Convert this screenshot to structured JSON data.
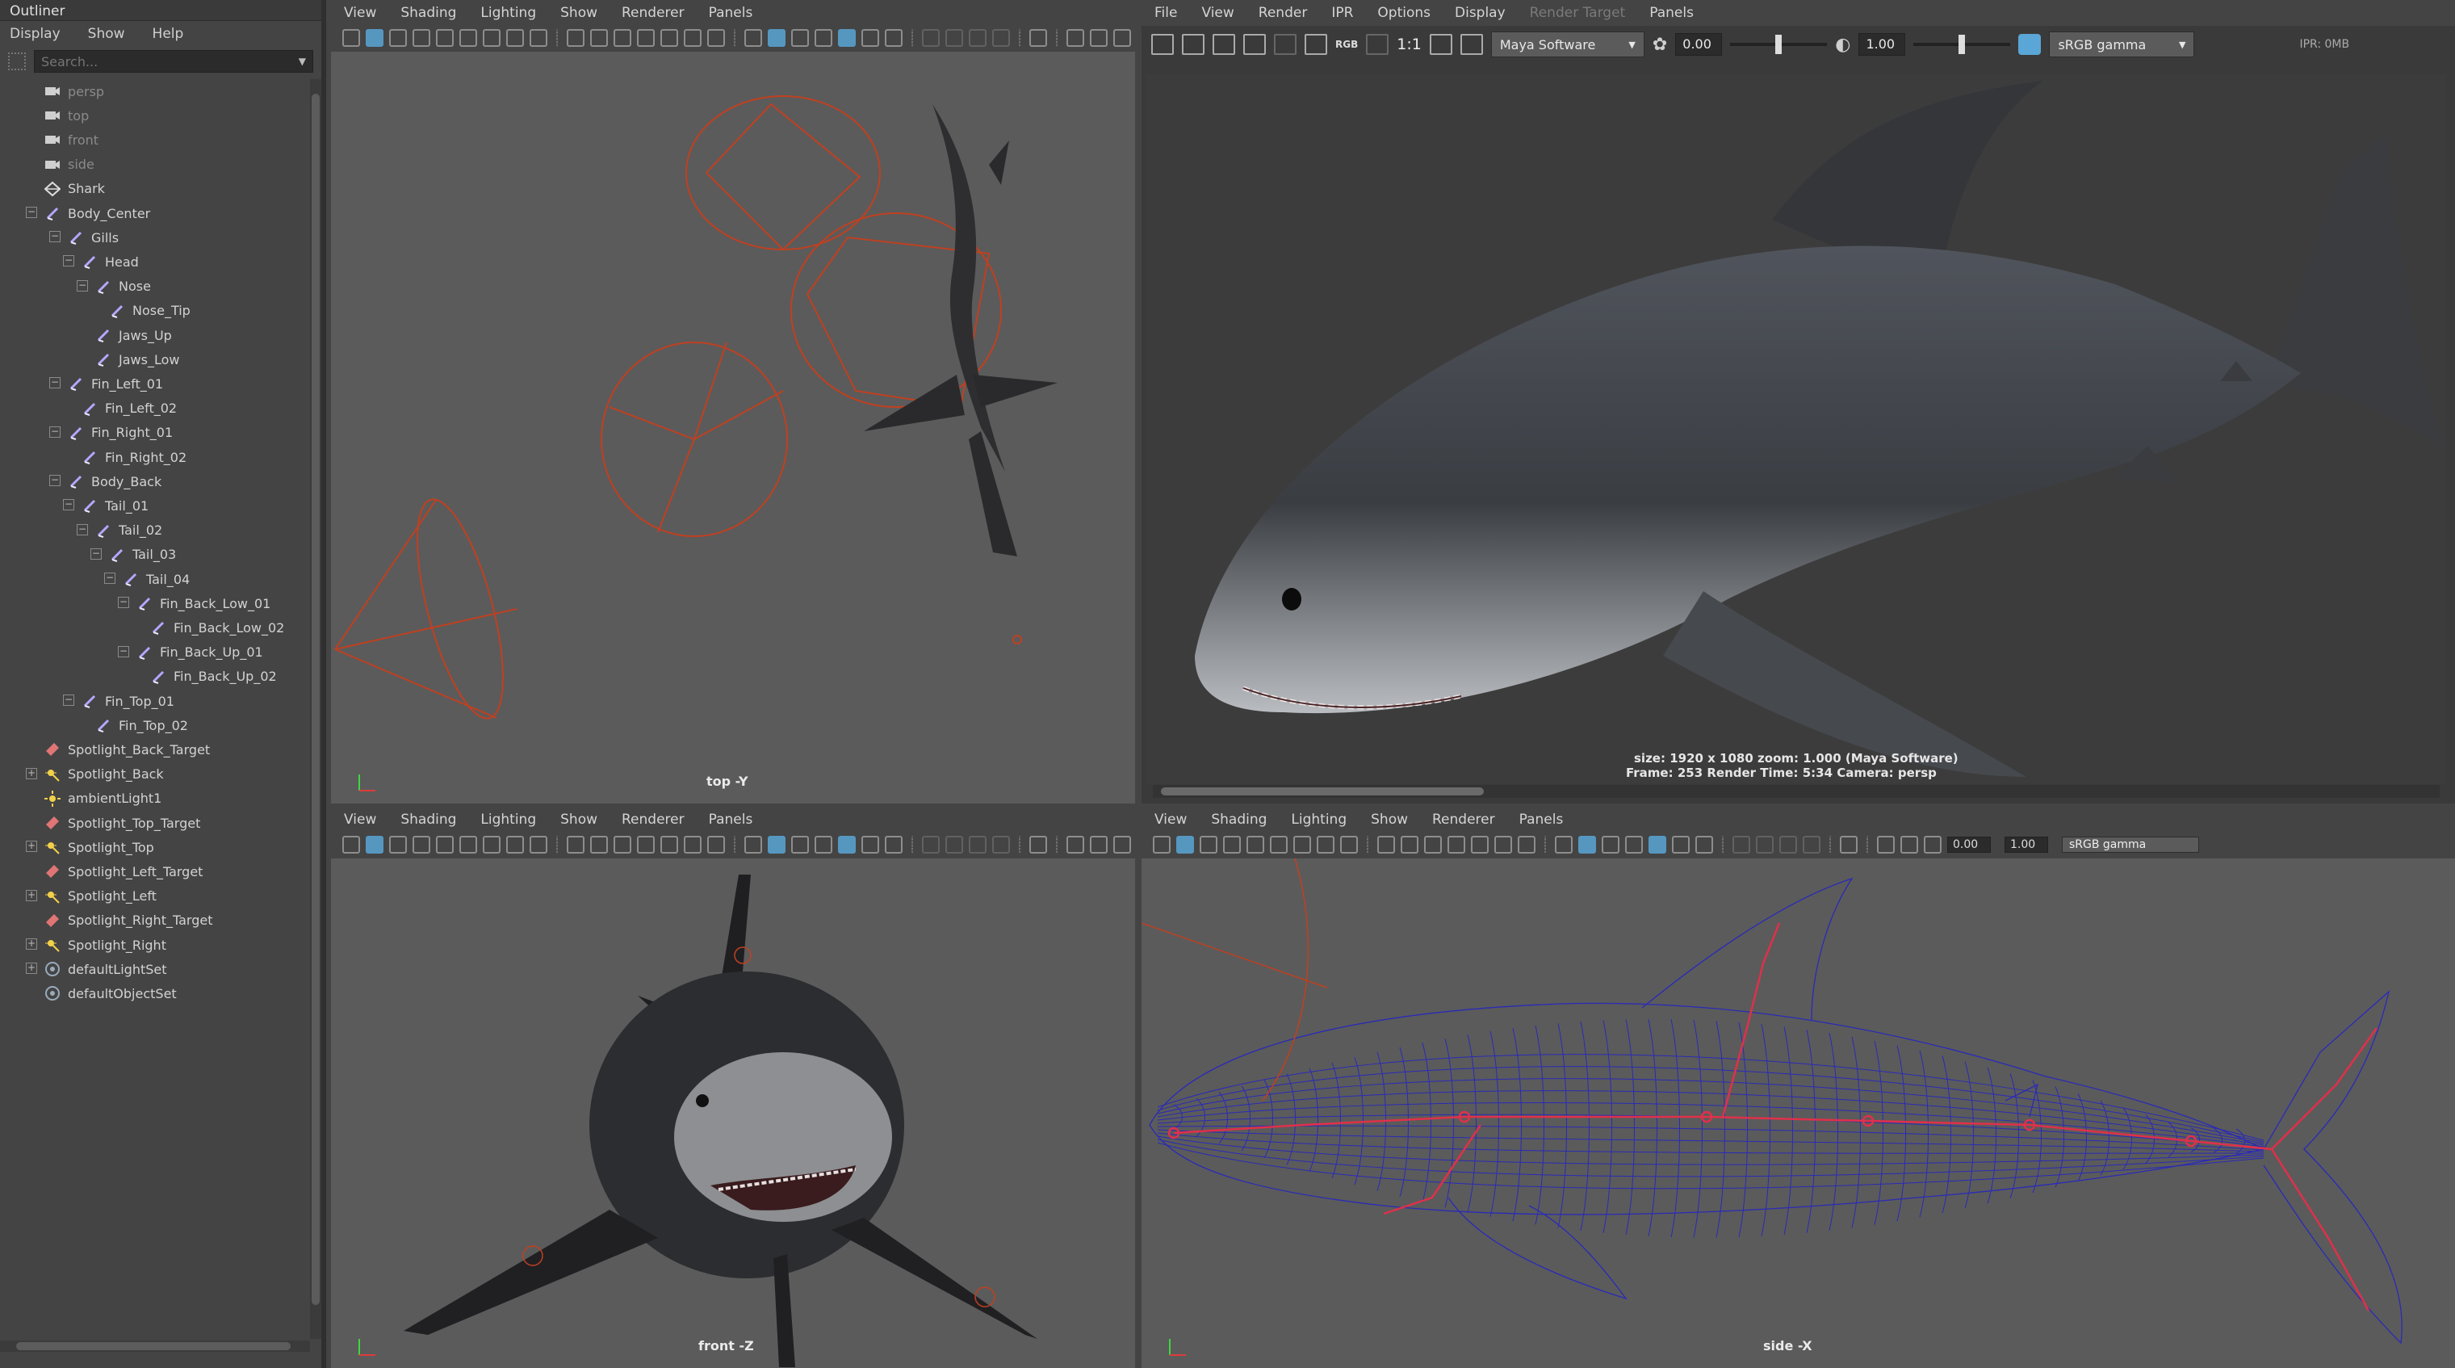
{
  "outliner": {
    "title": "Outliner",
    "menu": [
      "Display",
      "Show",
      "Help"
    ],
    "search_placeholder": "Search...",
    "items": [
      {
        "label": "persp",
        "type": "camera",
        "dim": true
      },
      {
        "label": "top",
        "type": "camera",
        "dim": true
      },
      {
        "label": "front",
        "type": "camera",
        "dim": true
      },
      {
        "label": "side",
        "type": "camera",
        "dim": true
      },
      {
        "label": "Shark",
        "type": "mesh"
      },
      {
        "label": "Body_Center",
        "type": "joint"
      },
      {
        "label": "Gills",
        "type": "joint"
      },
      {
        "label": "Head",
        "type": "joint"
      },
      {
        "label": "Nose",
        "type": "joint"
      },
      {
        "label": "Nose_Tip",
        "type": "joint"
      },
      {
        "label": "Jaws_Up",
        "type": "joint"
      },
      {
        "label": "Jaws_Low",
        "type": "joint"
      },
      {
        "label": "Fin_Left_01",
        "type": "joint"
      },
      {
        "label": "Fin_Left_02",
        "type": "joint"
      },
      {
        "label": "Fin_Right_01",
        "type": "joint"
      },
      {
        "label": "Fin_Right_02",
        "type": "joint"
      },
      {
        "label": "Body_Back",
        "type": "joint"
      },
      {
        "label": "Tail_01",
        "type": "joint"
      },
      {
        "label": "Tail_02",
        "type": "joint"
      },
      {
        "label": "Tail_03",
        "type": "joint"
      },
      {
        "label": "Tail_04",
        "type": "joint"
      },
      {
        "label": "Fin_Back_Low_01",
        "type": "joint"
      },
      {
        "label": "Fin_Back_Low_02",
        "type": "joint"
      },
      {
        "label": "Fin_Back_Up_01",
        "type": "joint"
      },
      {
        "label": "Fin_Back_Up_02",
        "type": "joint"
      },
      {
        "label": "Fin_Top_01",
        "type": "joint"
      },
      {
        "label": "Fin_Top_02",
        "type": "joint"
      },
      {
        "label": "Spotlight_Back_Target",
        "type": "target"
      },
      {
        "label": "Spotlight_Back",
        "type": "spotlight"
      },
      {
        "label": "ambientLight1",
        "type": "ambient"
      },
      {
        "label": "Spotlight_Top_Target",
        "type": "target"
      },
      {
        "label": "Spotlight_Top",
        "type": "spotlight"
      },
      {
        "label": "Spotlight_Left_Target",
        "type": "target"
      },
      {
        "label": "Spotlight_Left",
        "type": "spotlight"
      },
      {
        "label": "Spotlight_Right_Target",
        "type": "target"
      },
      {
        "label": "Spotlight_Right",
        "type": "spotlight"
      },
      {
        "label": "defaultLightSet",
        "type": "set"
      },
      {
        "label": "defaultObjectSet",
        "type": "set"
      }
    ]
  },
  "viewport_menu": [
    "View",
    "Shading",
    "Lighting",
    "Show",
    "Renderer",
    "Panels"
  ],
  "viewports": {
    "top": {
      "camera": "top -Y"
    },
    "front": {
      "camera": "front -Z"
    },
    "side": {
      "camera": "side -X",
      "exposure": "0.00",
      "gamma": "1.00",
      "color_space": "sRGB gamma"
    }
  },
  "render_view": {
    "menu": [
      "File",
      "View",
      "Render",
      "IPR",
      "Options",
      "Display",
      "Render Target",
      "Panels"
    ],
    "ratio_label": "1:1",
    "renderer": "Maya Software",
    "exposure": "0.00",
    "gamma": "1.00",
    "color_space": "sRGB gamma",
    "ipr_memory": "IPR: 0MB",
    "info_line1": "size: 1920 x 1080  zoom: 1.000        (Maya Software)",
    "info_line2": "Frame: 253      Render Time: 5:34      Camera: persp"
  },
  "colors": {
    "wireframe": "#2a2ab8",
    "joint": "#e0304a",
    "light_manip": "#c04020",
    "accent": "#5aa6d6"
  }
}
